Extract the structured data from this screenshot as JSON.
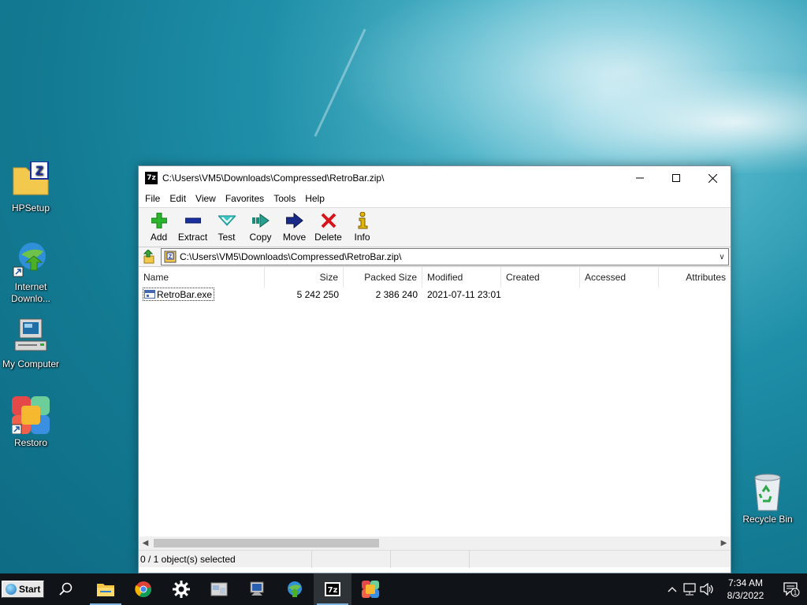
{
  "desktop": {
    "icons": [
      {
        "label": "HPSetup",
        "icon": "zip-folder-icon"
      },
      {
        "label": "Internet Downlo...",
        "icon": "idm-globe-icon"
      },
      {
        "label": "My Computer",
        "icon": "computer-icon"
      },
      {
        "label": "Restoro",
        "icon": "restoro-icon"
      },
      {
        "label": "Recycle Bin",
        "icon": "recycle-bin-icon"
      }
    ]
  },
  "window": {
    "title": "C:\\Users\\VM5\\Downloads\\Compressed\\RetroBar.zip\\",
    "app_icon_text": "7z",
    "menu": [
      "File",
      "Edit",
      "View",
      "Favorites",
      "Tools",
      "Help"
    ],
    "toolbar": [
      {
        "label": "Add",
        "icon": "plus-icon"
      },
      {
        "label": "Extract",
        "icon": "minus-icon"
      },
      {
        "label": "Test",
        "icon": "check-icon"
      },
      {
        "label": "Copy",
        "icon": "copy-arrow-icon"
      },
      {
        "label": "Move",
        "icon": "move-arrow-icon"
      },
      {
        "label": "Delete",
        "icon": "delete-x-icon"
      },
      {
        "label": "Info",
        "icon": "info-icon"
      }
    ],
    "address": "C:\\Users\\VM5\\Downloads\\Compressed\\RetroBar.zip\\",
    "columns": [
      "Name",
      "Size",
      "Packed Size",
      "Modified",
      "Created",
      "Accessed",
      "Attributes"
    ],
    "files": [
      {
        "name": "RetroBar.exe",
        "size": "5 242 250",
        "packed_size": "2 386 240",
        "modified": "2021-07-11 23:01",
        "created": "",
        "accessed": "",
        "attributes": ""
      }
    ],
    "status": "0 / 1 object(s) selected"
  },
  "taskbar": {
    "start_label": "Start",
    "clock_time": "7:34 AM",
    "clock_date": "8/3/2022",
    "notification_count": "1"
  },
  "colors": {
    "accent_green": "#2bb42b",
    "delete_red": "#d8141b",
    "extract_blue": "#1a2fa0"
  }
}
